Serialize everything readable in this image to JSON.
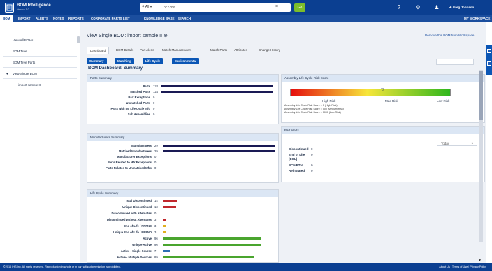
{
  "app": {
    "name": "BOM Intelligence",
    "version": "Version 1.0"
  },
  "search": {
    "scope": "All",
    "value": "bc238x",
    "go_label": "Go"
  },
  "header": {
    "user_label": "Hi Greg Johnson"
  },
  "nav": {
    "items": [
      "BOM",
      "IMPORT",
      "ALERTS",
      "NOTES",
      "REPORTS",
      "CORPORATE PARTS LIST",
      "KNOWLEDGE BASE",
      "SEARCH"
    ],
    "active": "BOM",
    "right": "MY WORKSPACE"
  },
  "sidebar": {
    "items": [
      {
        "label": "View All BOMs"
      },
      {
        "label": "BOM Tree"
      },
      {
        "label": "BOM Tree Parts"
      },
      {
        "label": "View Single BOM",
        "expanded": true
      },
      {
        "label": "import sample II",
        "selected": true
      }
    ]
  },
  "page": {
    "title": "View Single BOM: import sample II ⊕",
    "remove_link": "Remove this BOM from Workspace",
    "tabs": [
      "Dashboard",
      "BOM Details",
      "Part Alerts",
      "Match Manufacturers",
      "Match Parts",
      "Attributes",
      "Change History"
    ],
    "active_tab": "Dashboard",
    "subtabs": [
      "Summary",
      "Matching",
      "Life Cycle",
      "Environmental"
    ],
    "dashboard_title": "BOM Dashboard: Summary"
  },
  "parts_summary": {
    "title": "Parts Summary",
    "rows": [
      {
        "label": "Parts",
        "value": 124,
        "color": "#1a1a55"
      },
      {
        "label": "Matched Parts",
        "value": 124,
        "color": "#1a1a55"
      },
      {
        "label": "Part Exceptions",
        "value": 0,
        "color": ""
      },
      {
        "label": "Unmatched Parts",
        "value": 0,
        "color": ""
      },
      {
        "label": "Parts with No Life Cycle Info",
        "value": 0,
        "color": ""
      },
      {
        "label": "Sub Assemblies",
        "value": 0,
        "color": ""
      }
    ],
    "max": 124
  },
  "manufacturers_summary": {
    "title": "Manufacturers Summary",
    "rows": [
      {
        "label": "Manufacturers",
        "value": 29,
        "color": "#1a1a55"
      },
      {
        "label": "Matched Manufacturers",
        "value": 29,
        "color": "#1a1a55"
      },
      {
        "label": "Manufacturer Exceptions",
        "value": 0,
        "color": ""
      },
      {
        "label": "Parts Related to Mfr Exceptions",
        "value": 0,
        "color": ""
      },
      {
        "label": "Parts Related to Unmatched Mfrs",
        "value": 0,
        "color": ""
      }
    ],
    "max": 29
  },
  "life_cycle_summary": {
    "title": "Life Cycle Summary",
    "rows": [
      {
        "label": "Total Discontinued",
        "value": 14,
        "color": "#c0282d"
      },
      {
        "label": "Unique Discontinued",
        "value": 13,
        "color": "#c0282d"
      },
      {
        "label": "Discontinued with Alternates",
        "value": 0,
        "color": ""
      },
      {
        "label": "Discontinued without Alternates",
        "value": 3,
        "color": "#c0282d"
      },
      {
        "label": "End of Life / NRFND",
        "value": 3,
        "color": "#e0b020"
      },
      {
        "label": "Unique End of Life / NRFND",
        "value": 3,
        "color": "#e0b020"
      },
      {
        "label": "Active",
        "value": 96,
        "color": "#4aa52e"
      },
      {
        "label": "Unique Active",
        "value": 96,
        "color": "#4aa52e"
      },
      {
        "label": "Active - Single Source",
        "value": 7,
        "color": "#2d6fb5"
      },
      {
        "label": "Active - Multiple Sources",
        "value": 89,
        "color": "#4aa52e"
      }
    ],
    "max": 96
  },
  "risk_score": {
    "title": "Assembly Life Cycle Risk Score",
    "score_fraction": 0.58,
    "labels": [
      "High Risk",
      "Med Risk",
      "Low Risk"
    ],
    "notes": [
      "Assembly Life Cycle Risk Score = 1 (High Risk)",
      "Assembly Life Cycle Risk Score = 500 (Medium Risk)",
      "Assembly Life Cycle Risk Score = 1000 (Low Risk)"
    ]
  },
  "part_alerts": {
    "title": "Part Alerts",
    "period": "Today",
    "rows": [
      {
        "label": "Discontinued",
        "value": "0"
      },
      {
        "label": "End of Life",
        "value": "0"
      },
      {
        "label": "(EOL)",
        "value": ""
      },
      {
        "label": "PCN/PTN",
        "value": "0"
      },
      {
        "label": "Reinstated",
        "value": "0"
      }
    ]
  },
  "footer": {
    "left": "©2016 IHS Inc. All rights reserved. Reproduction in whole or in part without permission is prohibited.",
    "right": "About Us  |  Terms of Use  |  Privacy Policy"
  }
}
